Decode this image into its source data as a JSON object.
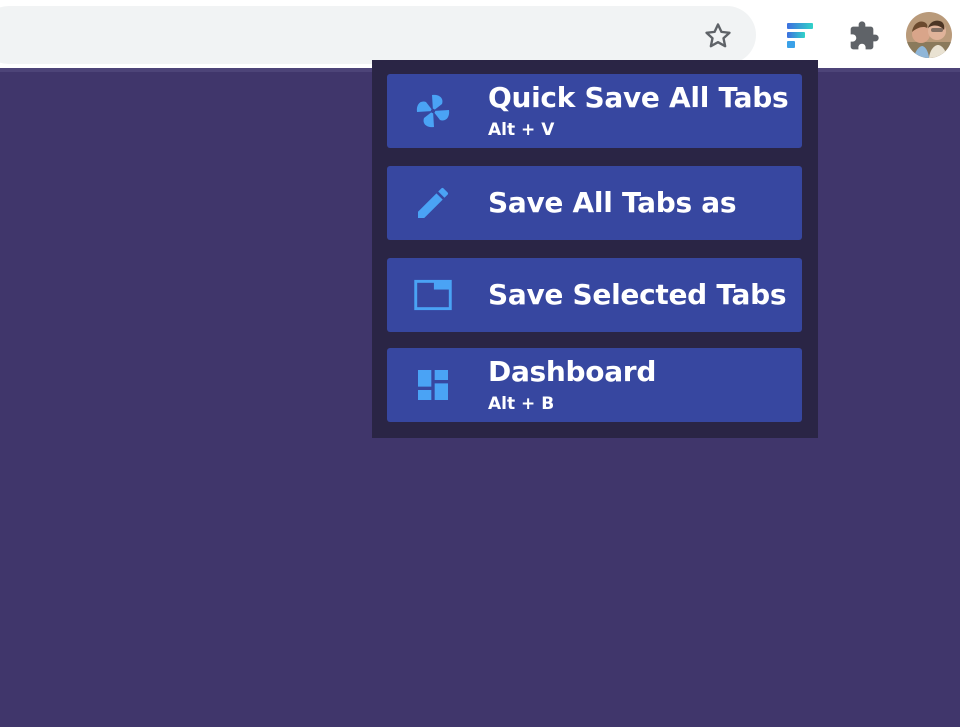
{
  "browser": {
    "icons": {
      "bookmark": "star-outline-icon",
      "extension_tabsave": "tabsave-logo-icon",
      "extensions": "puzzle-piece-icon",
      "profile": "profile-avatar"
    }
  },
  "popup": {
    "items": [
      {
        "label": "Quick Save All Tabs",
        "shortcut": "Alt + V",
        "icon": "pinwheel-icon"
      },
      {
        "label": "Save All Tabs as",
        "shortcut": "",
        "icon": "pencil-icon"
      },
      {
        "label": "Save Selected Tabs",
        "shortcut": "",
        "icon": "tab-window-icon"
      },
      {
        "label": "Dashboard",
        "shortcut": "Alt + B",
        "icon": "dashboard-icon"
      }
    ]
  },
  "colors": {
    "page_background": "#40366b",
    "popup_background": "#2a2545",
    "menu_item_background": "#3747a0",
    "menu_icon": "#4aa3f5",
    "menu_text": "#ffffff"
  }
}
